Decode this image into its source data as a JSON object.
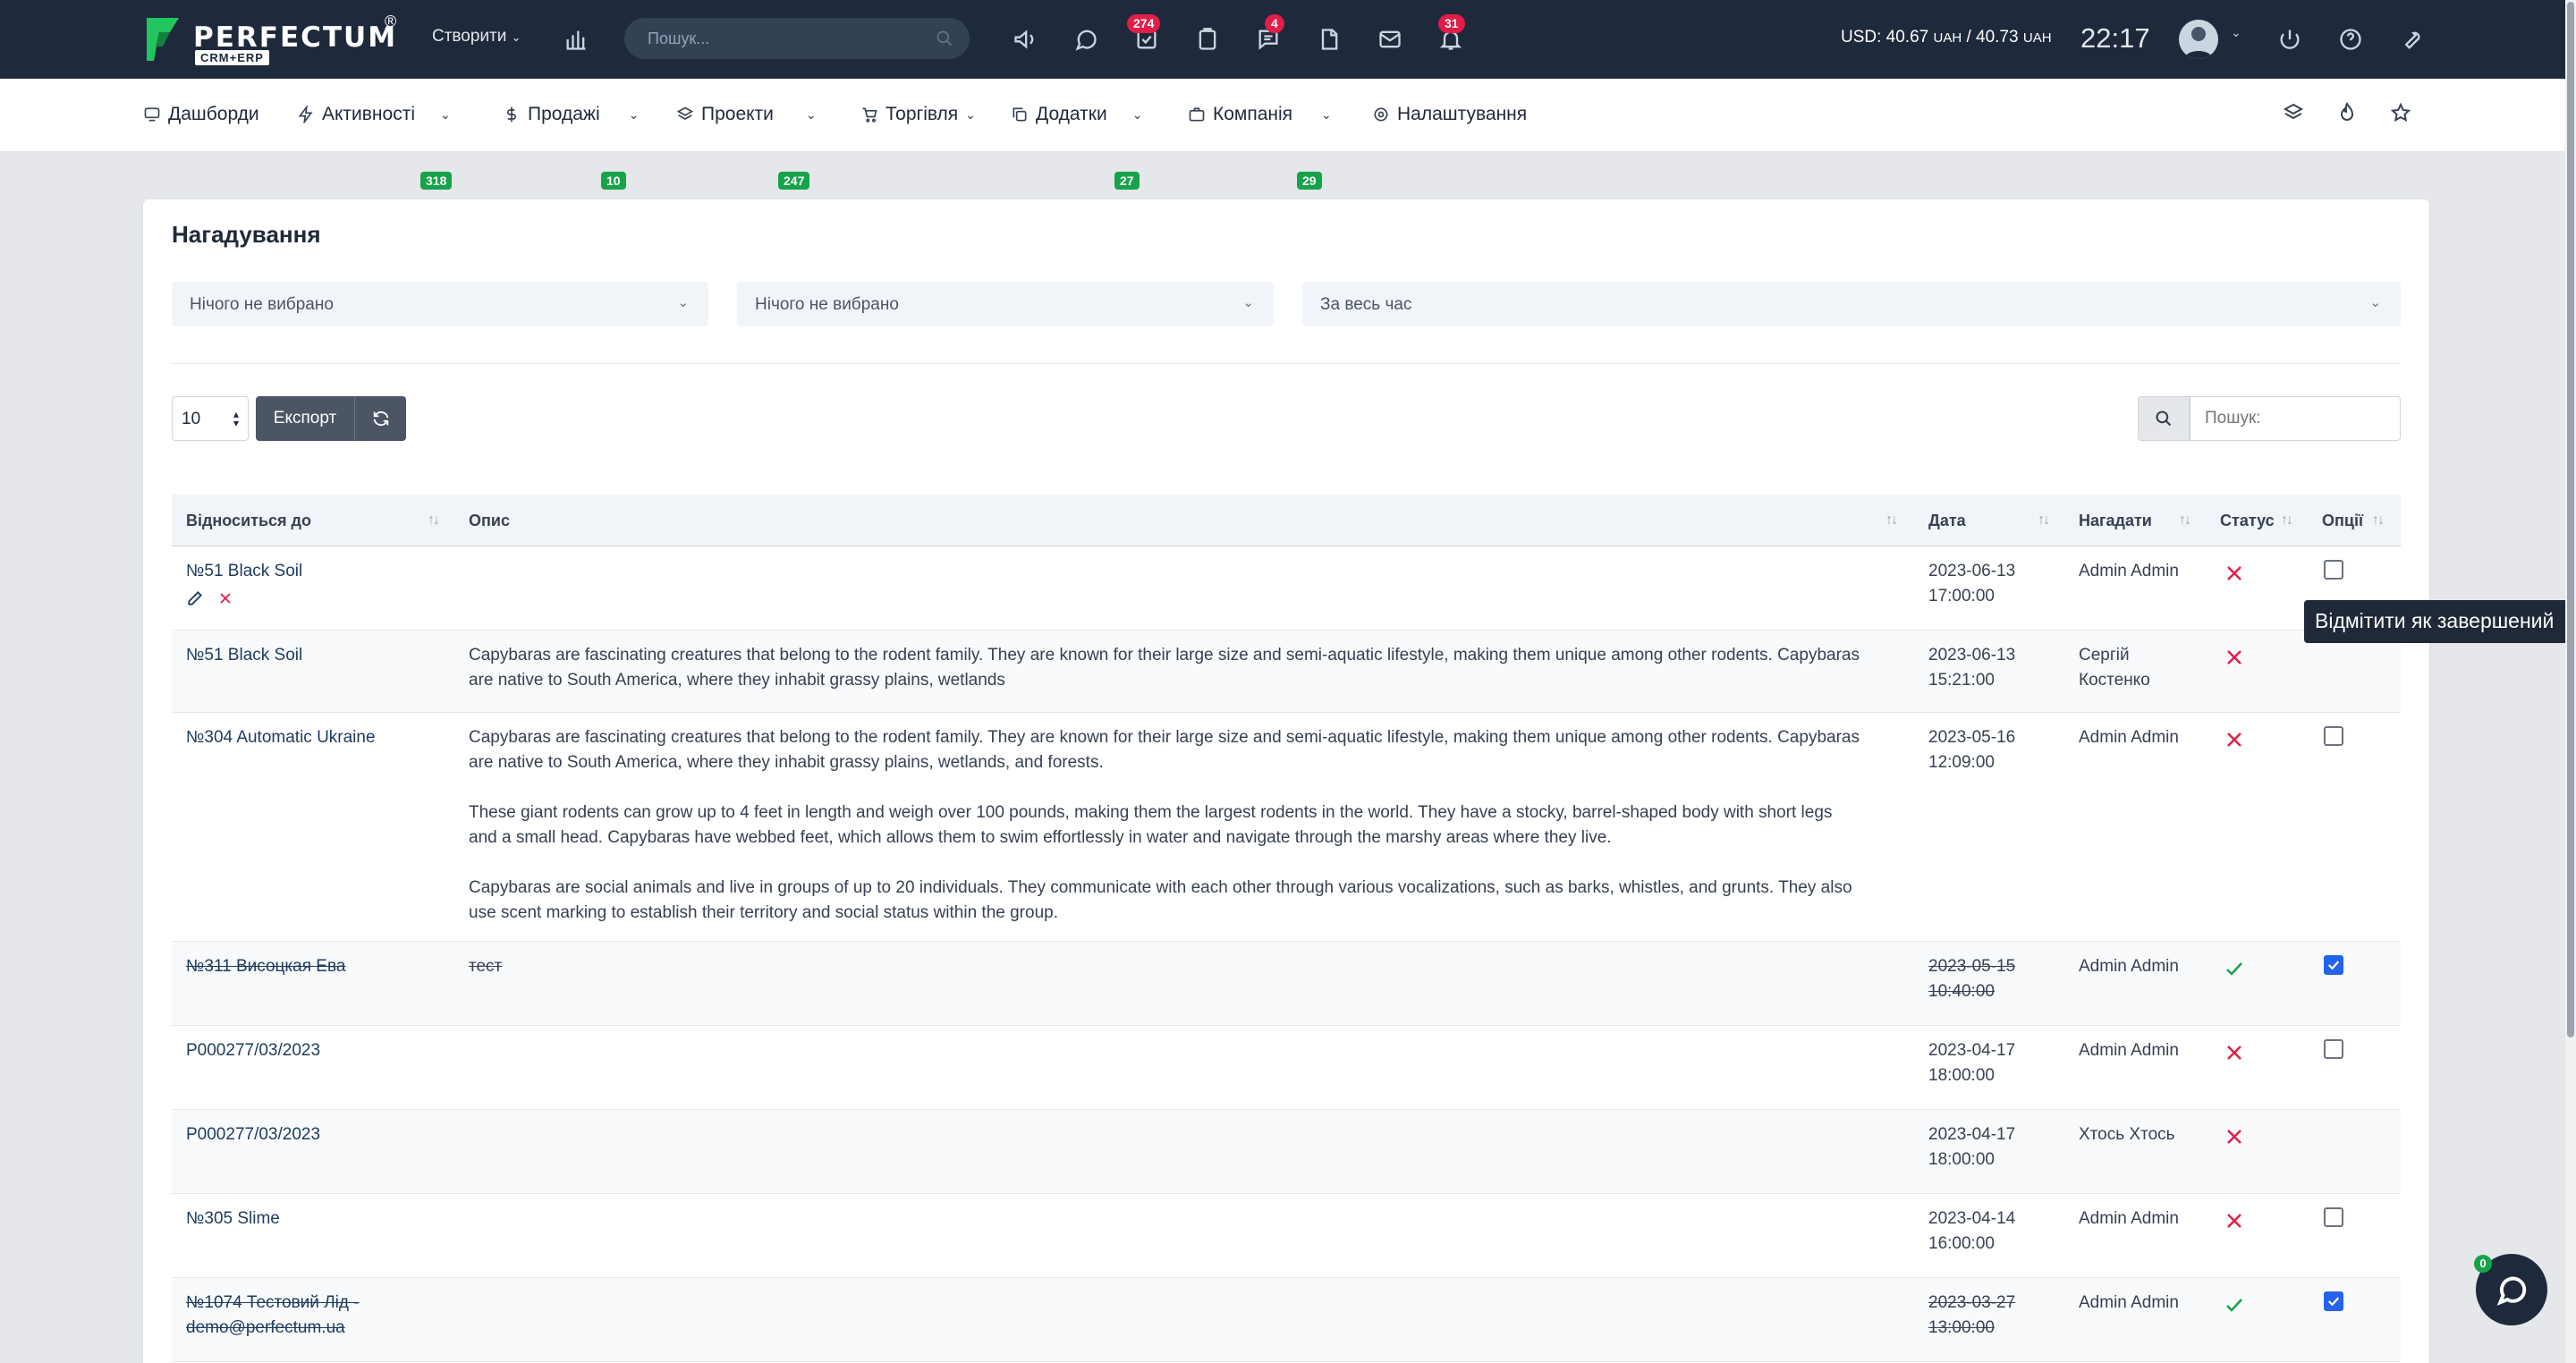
{
  "header": {
    "logo_name": "PERFECTUM",
    "logo_reg": "®",
    "logo_sub": "CRM+ERP",
    "create_label": "Створити",
    "search_placeholder": "Пошук...",
    "badges": {
      "tasks": "274",
      "chat": "4",
      "notifications": "31"
    },
    "usd_label": "USD: 40.67",
    "usd_unit1": "UAH",
    "usd_sep": " / 40.73",
    "usd_unit2": "UAH",
    "time": "22:17"
  },
  "nav": {
    "items": [
      {
        "label": "Дашборди"
      },
      {
        "label": "Активності",
        "badge": "318"
      },
      {
        "label": "Продажі",
        "badge": "10"
      },
      {
        "label": "Проекти",
        "badge": "247"
      },
      {
        "label": "Торгівля"
      },
      {
        "label": "Додатки",
        "badge": "27"
      },
      {
        "label": "Компанія",
        "badge": "29"
      },
      {
        "label": "Налаштування"
      }
    ]
  },
  "page": {
    "title": "Нагадування",
    "filters": [
      "Нічого не вибрано",
      "Нічого не вибрано",
      "За весь час"
    ],
    "page_length": "10",
    "export_label": "Експорт",
    "search_label": "Пошук:"
  },
  "table": {
    "columns": [
      "Відноситься до",
      "Опис",
      "Дата",
      "Нагадати",
      "Статус",
      "Опції"
    ],
    "rows": [
      {
        "rel": "№51 Black Soil",
        "desc": [],
        "date": "2023-06-13",
        "time": "17:00:00",
        "remind": "Admin Admin",
        "status": "open",
        "checkbox": "unchecked"
      },
      {
        "rel": "№51 Black Soil",
        "desc": [
          "Capybaras are fascinating creatures that belong to the rodent family. They are known for their large size and semi-aquatic lifestyle, making them unique among other rodents. Capybaras are native to South America, where they inhabit grassy plains, wetlands"
        ],
        "date": "2023-06-13",
        "time": "15:21:00",
        "remind": "Сергій Костенко",
        "status": "open",
        "checkbox": "none"
      },
      {
        "rel": "№304 Automatic Ukraine",
        "desc": [
          "Capybaras are fascinating creatures that belong to the rodent family. They are known for their large size and semi-aquatic lifestyle, making them unique among other rodents. Capybaras are native to South America, where they inhabit grassy plains, wetlands, and forests.",
          "These giant rodents can grow up to 4 feet in length and weigh over 100 pounds, making them the largest rodents in the world. They have a stocky, barrel-shaped body with short legs and a small head. Capybaras have webbed feet, which allows them to swim effortlessly in water and navigate through the marshy areas where they live.",
          "Capybaras are social animals and live in groups of up to 20 individuals. They communicate with each other through various vocalizations, such as barks, whistles, and grunts. They also use scent marking to establish their territory and social status within the group."
        ],
        "date": "2023-05-16",
        "time": "12:09:00",
        "remind": "Admin Admin",
        "status": "open",
        "checkbox": "unchecked"
      },
      {
        "rel": "№311 Висоцкая Ева",
        "desc": [
          "тест"
        ],
        "date": "2023-05-15",
        "time": "10:40:00",
        "remind": "Admin Admin",
        "status": "done",
        "checkbox": "checked"
      },
      {
        "rel": "P000277/03/2023",
        "desc": [],
        "date": "2023-04-17",
        "time": "18:00:00",
        "remind": "Admin Admin",
        "status": "open",
        "checkbox": "unchecked"
      },
      {
        "rel": "P000277/03/2023",
        "desc": [],
        "date": "2023-04-17",
        "time": "18:00:00",
        "remind": "Хтось Хтось",
        "status": "open",
        "checkbox": "none"
      },
      {
        "rel": "№305 Slime",
        "desc": [],
        "date": "2023-04-14",
        "time": "16:00:00",
        "remind": "Admin Admin",
        "status": "open",
        "checkbox": "unchecked"
      },
      {
        "rel": "№1074 Тестовий Лід - demo@perfectum.ua",
        "desc": [],
        "date": "2023-03-27",
        "time": "13:00:00",
        "remind": "Admin Admin",
        "status": "done",
        "checkbox": "checked"
      }
    ]
  },
  "tooltip": "Відмітити як завершений",
  "chat_badge": "0",
  "colors": {
    "topbar": "#1e293b",
    "badge_red": "#e11d48",
    "badge_green": "#16a34a",
    "link": "#1e3a5f",
    "check_blue": "#2563eb"
  }
}
